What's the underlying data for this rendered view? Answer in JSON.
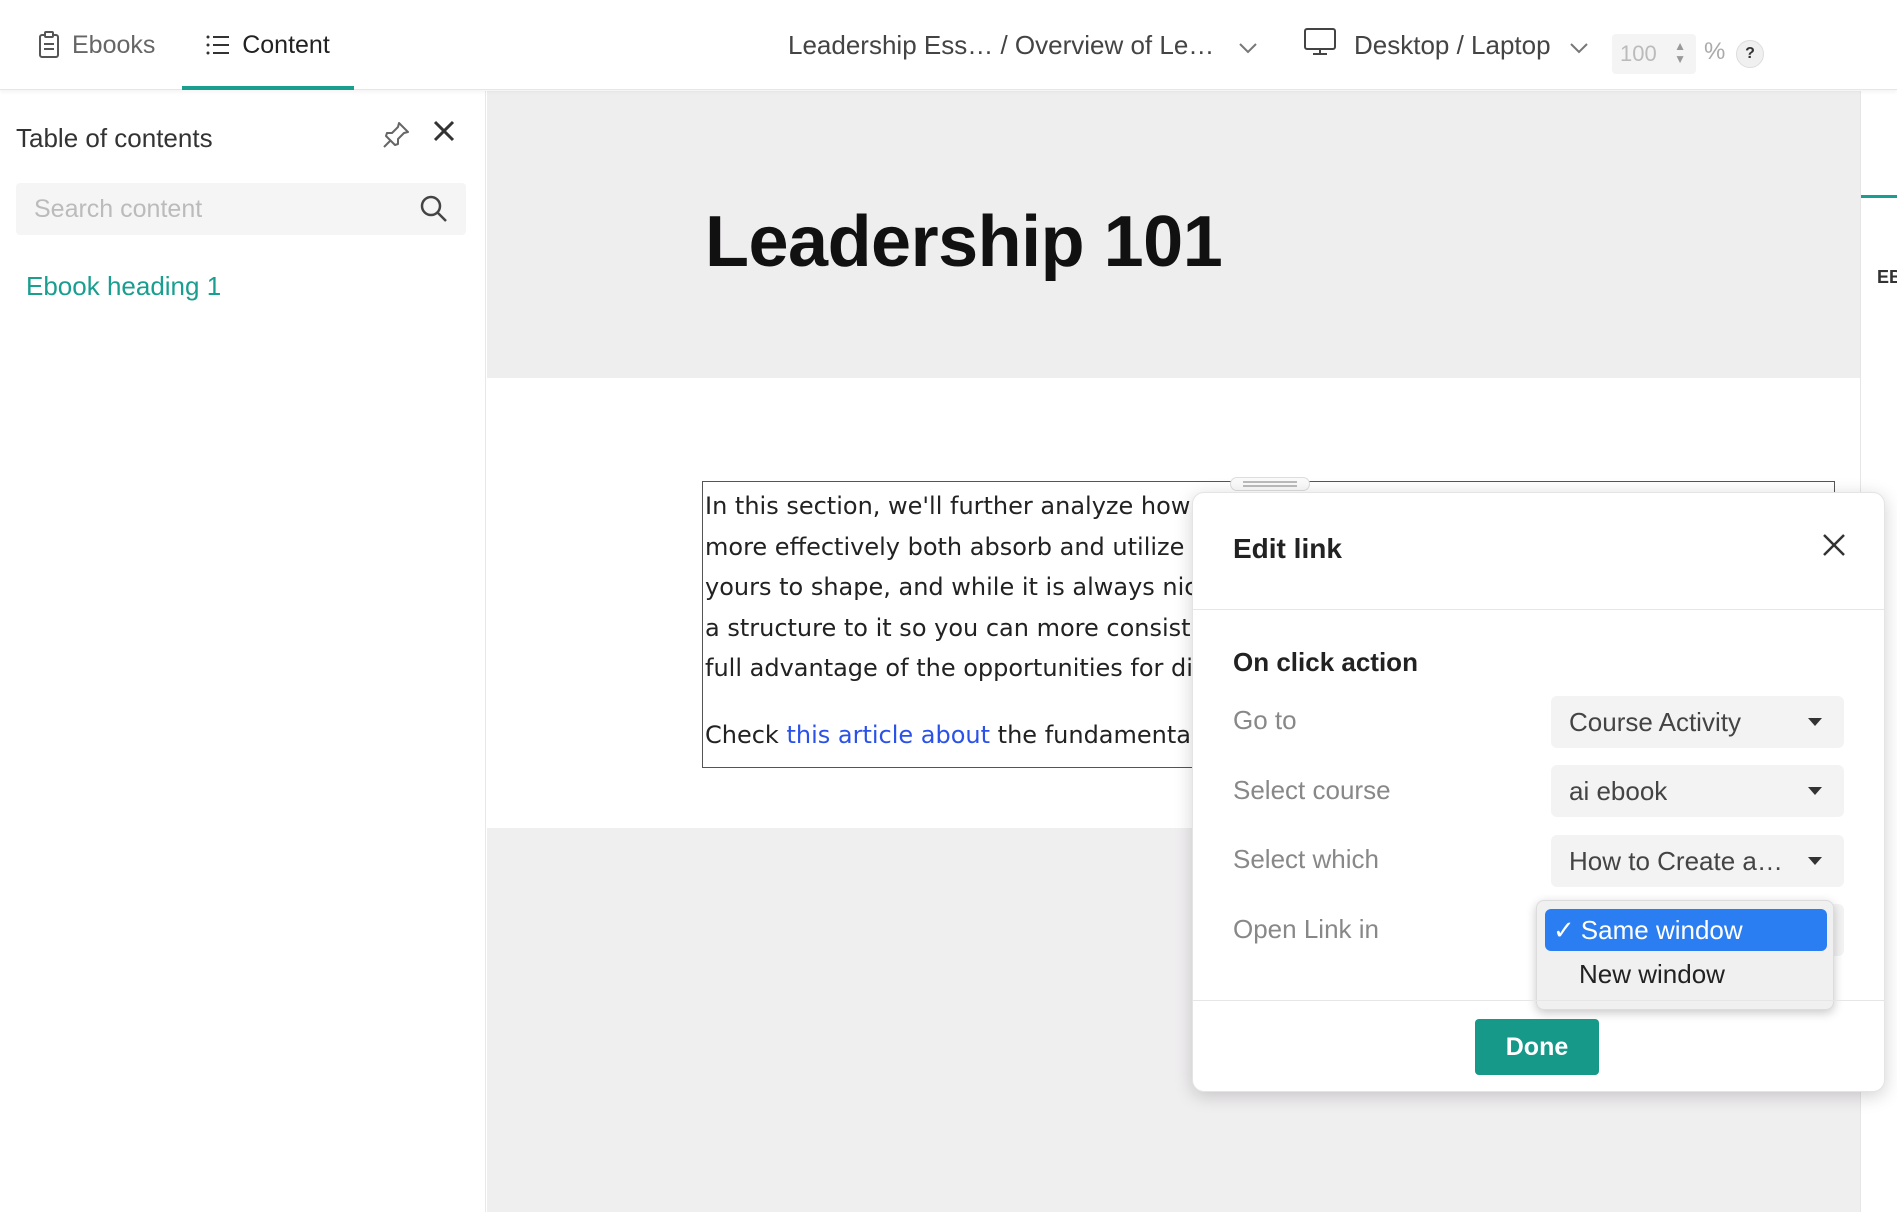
{
  "topbar": {
    "tabs": [
      {
        "label": "Ebooks",
        "icon": "clipboard-icon"
      },
      {
        "label": "Content",
        "icon": "list-icon"
      }
    ],
    "breadcrumb": "Leadership Ess… / Overview of Le…",
    "device": "Desktop / Laptop",
    "zoom": "100",
    "zoom_unit": "%",
    "help": "?"
  },
  "sidebar": {
    "title": "Table of contents",
    "search_placeholder": "Search content",
    "items": [
      "Ebook heading 1"
    ]
  },
  "page": {
    "title": "Leadership 101",
    "paragraph_lines": [
      "In this section, we'll further analyze how to",
      "more effectively both absorb and utilize yo",
      "yours to shape, and while it is always nice",
      "a structure to it so you can more consisten",
      "full advantage of the opportunities for dis"
    ],
    "link_line": {
      "prefix": "Check ",
      "link": "this article about",
      "suffix": " the fundamentals"
    }
  },
  "right_panel": {
    "label": "EB"
  },
  "modal": {
    "title": "Edit link",
    "section": "On click action",
    "rows": [
      {
        "label": "Go to",
        "value": "Course Activity"
      },
      {
        "label": "Select course",
        "value": "ai ebook"
      },
      {
        "label": "Select which",
        "value": "How to Create a…"
      },
      {
        "label": "Open Link in",
        "value": "Same window"
      }
    ],
    "open_options": [
      "Same window",
      "New window"
    ],
    "selected_option": "Same window",
    "done_label": "Done"
  },
  "colors": {
    "accent": "#1a9e8f",
    "link": "#2a52e8",
    "selected_option": "#2a7ef2",
    "done_button": "#17998a"
  }
}
